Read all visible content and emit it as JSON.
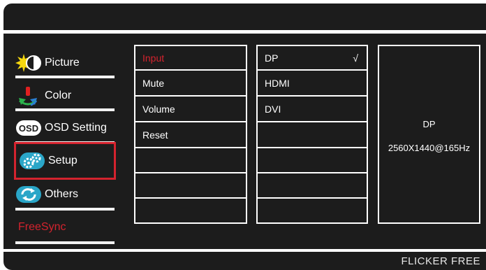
{
  "menu": {
    "items": [
      {
        "label": "Picture",
        "icon": "picture-icon"
      },
      {
        "label": "Color",
        "icon": "color-icon"
      },
      {
        "label": "OSD Setting",
        "icon": "osd-icon",
        "icon_text": "OSD"
      },
      {
        "label": "Setup",
        "icon": "setup-gear-icon"
      },
      {
        "label": "Others",
        "icon": "others-refresh-icon"
      }
    ],
    "freesync_label": "FreeSync",
    "selected": "Setup"
  },
  "submenu": {
    "items": [
      "Input",
      "Mute",
      "Volume",
      "Reset",
      "",
      "",
      ""
    ],
    "active": "Input"
  },
  "options": {
    "items": [
      "DP",
      "HDMI",
      "DVI",
      "",
      "",
      "",
      ""
    ],
    "checked": "DP",
    "check_mark": "√"
  },
  "info": {
    "source": "DP",
    "resolution": "2560X1440@165Hz"
  },
  "footer": {
    "label": "FLICKER FREE"
  },
  "colors": {
    "background": "#1c1c1c",
    "accent_red": "#d4232e",
    "text": "#ffffff"
  }
}
